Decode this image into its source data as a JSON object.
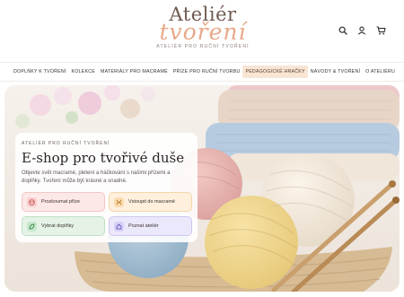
{
  "brand": {
    "line1": "Ateliér",
    "line2": "tvoření",
    "tagline": "Ateliér pro ruční tvoření"
  },
  "header_icons": [
    "search-icon",
    "user-icon",
    "cart-icon"
  ],
  "nav": {
    "items": [
      {
        "label": "Doplňky k tvoření",
        "active": false
      },
      {
        "label": "Kolekce",
        "active": false
      },
      {
        "label": "Materiály pro macramé",
        "active": false
      },
      {
        "label": "Příze pro ruční tvorbu",
        "active": false
      },
      {
        "label": "Pedagogické hračky",
        "active": true
      },
      {
        "label": "Návody & tvoření",
        "active": false
      },
      {
        "label": "O ateliéru",
        "active": false
      }
    ]
  },
  "hero": {
    "eyebrow": "Ateliér pro ruční tvoření",
    "title": "E-shop pro tvořivé duše",
    "text": "Objevte svět macramé, pletení a háčkování s našimi přízemi a doplňky. Tvoření může být krásné a snadné.",
    "buttons": [
      {
        "label": "Prozkoumat příze",
        "icon": "yarn-icon"
      },
      {
        "label": "Vstoupit do macramé",
        "icon": "knot-icon"
      },
      {
        "label": "Vybrat doplňky",
        "icon": "leaf-icon"
      },
      {
        "label": "Poznat ateliér",
        "icon": "home-icon"
      }
    ]
  },
  "colors": {
    "accent": "#e8a98a",
    "nav_active_bg": "#f8e5d4",
    "brand_text": "#6f5a50"
  }
}
